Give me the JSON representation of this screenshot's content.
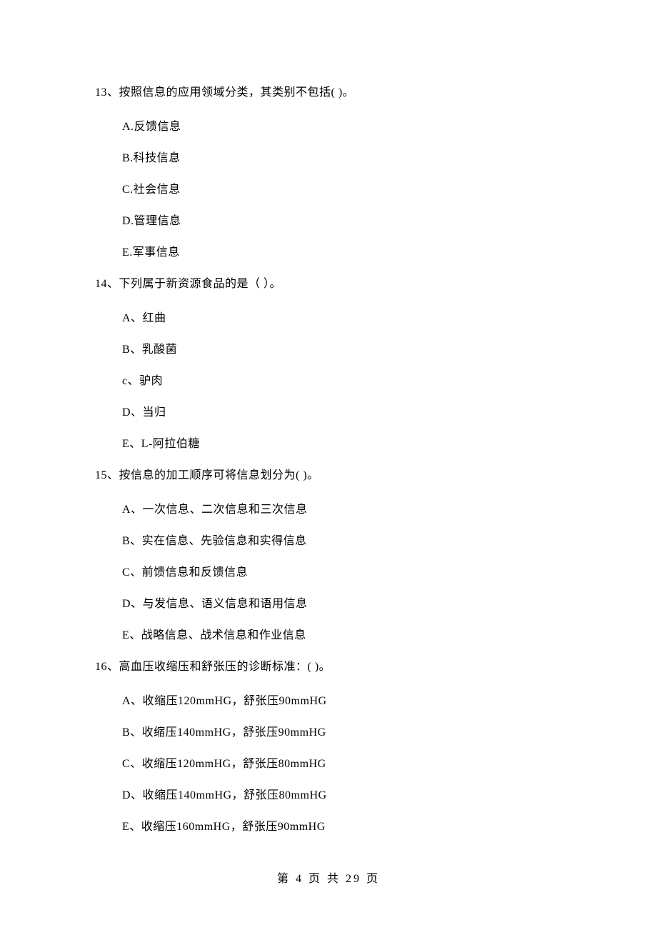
{
  "questions": [
    {
      "stem": "13、按照信息的应用领域分类，其类别不包括(    )。",
      "options": [
        "A.反馈信息",
        "B.科技信息",
        "C.社会信息",
        "D.管理信息",
        "E.军事信息"
      ]
    },
    {
      "stem": "14、下列属于新资源食品的是（    ）。",
      "options": [
        "A、红曲",
        "B、乳酸菌",
        "c、驴肉",
        "D、当归",
        "E、L-阿拉伯糖"
      ]
    },
    {
      "stem": "15、按信息的加工顺序可将信息划分为(    )。",
      "options": [
        "A、一次信息、二次信息和三次信息",
        "B、实在信息、先验信息和实得信息",
        "C、前馈信息和反馈信息",
        "D、与发信息、语义信息和语用信息",
        "E、战略信息、战术信息和作业信息"
      ]
    },
    {
      "stem": "16、高血压收缩压和舒张压的诊断标准：(    )。",
      "options": [
        "A、收缩压120mmHG，舒张压90mmHG",
        "B、收缩压140mmHG，舒张压90mmHG",
        "C、收缩压120mmHG，舒张压80mmHG",
        "D、收缩压140mmHG，舒张压80mmHG",
        "E、收缩压160mmHG，舒张压90mmHG"
      ]
    }
  ],
  "footer": "第 4 页 共 29 页"
}
